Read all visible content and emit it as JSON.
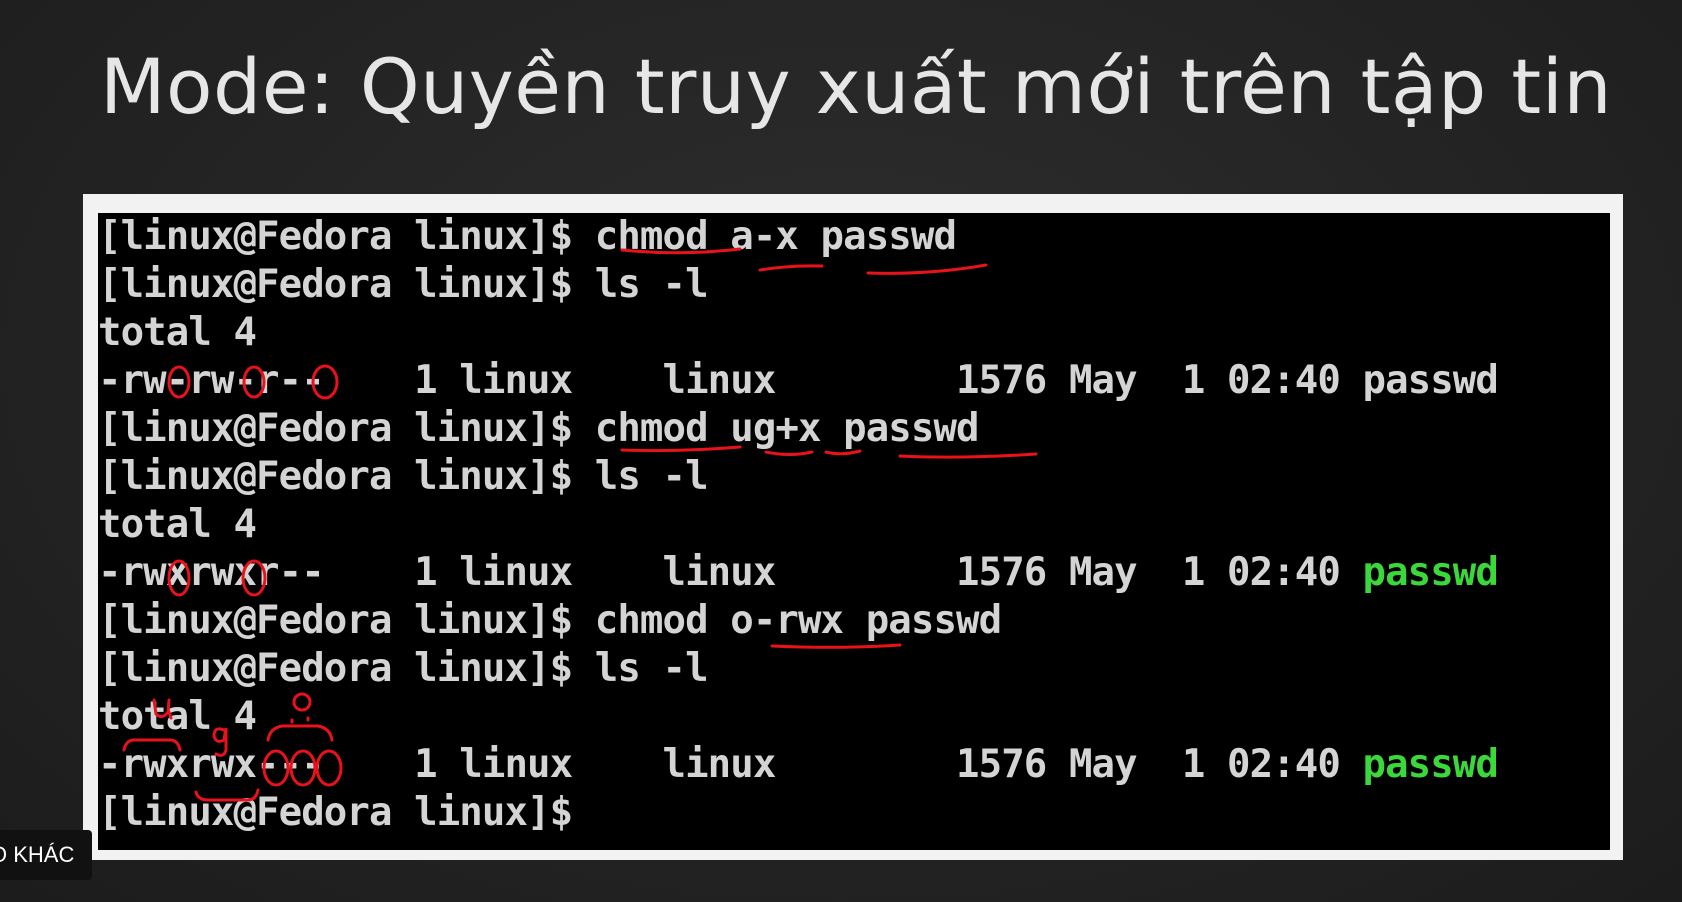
{
  "slide": {
    "title": "Mode: Quyền truy xuất mới trên tập tin"
  },
  "terminal": {
    "lines": [
      {
        "text": "[linux@Fedora linux]$ chmod a-x passwd"
      },
      {
        "text": "[linux@Fedora linux]$ ls -l"
      },
      {
        "text": "total 4"
      },
      {
        "text": "-rw-rw-r--    1 linux    linux        1576 May  1 02:40 ",
        "file": "passwd"
      },
      {
        "text": "[linux@Fedora linux]$ chmod ug+x passwd"
      },
      {
        "text": "[linux@Fedora linux]$ ls -l"
      },
      {
        "text": "total 4"
      },
      {
        "text": "-rwxrwxr--    1 linux    linux        1576 May  1 02:40 ",
        "file": "passwd",
        "file_color": "#3bd83b"
      },
      {
        "text": "[linux@Fedora linux]$ chmod o-rwx passwd"
      },
      {
        "text": "[linux@Fedora linux]$ ls -l"
      },
      {
        "text": "total 4"
      },
      {
        "text": "-rwxrwx---    1 linux    linux        1576 May  1 02:40 ",
        "file": "passwd",
        "file_color": "#3bd83b"
      },
      {
        "text": "[linux@Fedora linux]$"
      }
    ]
  },
  "annotations": {
    "ink_color": "#e8121b",
    "letters": [
      "u",
      "g",
      "o"
    ]
  },
  "overlay": {
    "badge": "O KHÁC"
  }
}
